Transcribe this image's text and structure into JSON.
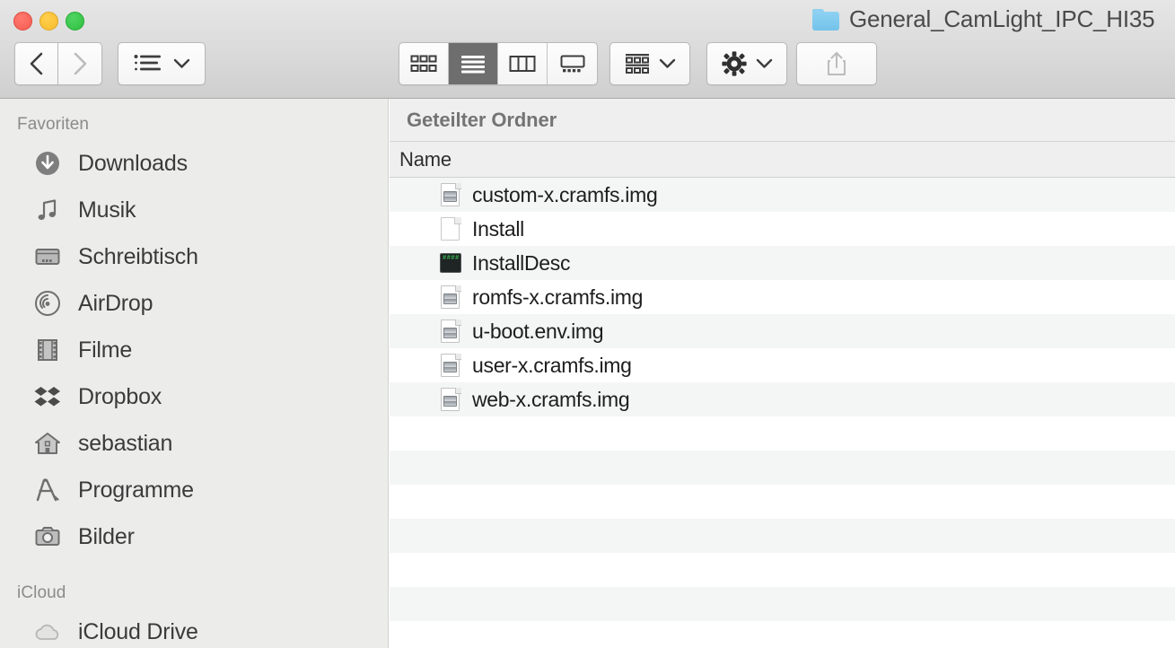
{
  "window": {
    "title": "General_CamLight_IPC_HI35",
    "folder_icon": "folder-icon",
    "traffic_lights": {
      "close": "close-button",
      "minimize": "minimize-button",
      "zoom": "zoom-button"
    },
    "colors": {
      "close": "#f45b51",
      "minimize": "#f7bb2c",
      "zoom": "#2ec03f",
      "toolbar_bg": "#dcdcdc",
      "sidebar_bg": "#ececeb",
      "row_stripe": "#f4f5f5",
      "active_segment": "#6e6e6e",
      "folder_blue": "#73c2ea"
    }
  },
  "toolbar": {
    "back": "back-button",
    "forward": "forward-button",
    "arrange": "arrange-items-button",
    "view_modes": [
      {
        "name": "icon-view",
        "active": false
      },
      {
        "name": "list-view",
        "active": true
      },
      {
        "name": "column-view",
        "active": false
      },
      {
        "name": "gallery-view",
        "active": false
      }
    ],
    "group_by": "group-by-button",
    "action": "action-button",
    "share": "share-button"
  },
  "sidebar": {
    "sections": [
      {
        "title": "Favoriten",
        "items": [
          {
            "label": "Downloads",
            "icon": "downloads-icon"
          },
          {
            "label": "Musik",
            "icon": "music-icon"
          },
          {
            "label": "Schreibtisch",
            "icon": "desktop-icon"
          },
          {
            "label": "AirDrop",
            "icon": "airdrop-icon"
          },
          {
            "label": "Filme",
            "icon": "movies-icon"
          },
          {
            "label": "Dropbox",
            "icon": "dropbox-icon"
          },
          {
            "label": "sebastian",
            "icon": "home-icon"
          },
          {
            "label": "Programme",
            "icon": "applications-icon"
          },
          {
            "label": "Bilder",
            "icon": "pictures-icon"
          }
        ]
      },
      {
        "title": "iCloud",
        "items": [
          {
            "label": "iCloud Drive",
            "icon": "icloud-drive-icon"
          }
        ]
      }
    ]
  },
  "content": {
    "path_label": "Geteilter Ordner",
    "columns": [
      "Name"
    ],
    "files": [
      {
        "name": "custom-x.cramfs.img",
        "icon": "disk-image-icon"
      },
      {
        "name": "Install",
        "icon": "document-icon"
      },
      {
        "name": "InstallDesc",
        "icon": "terminal-script-icon"
      },
      {
        "name": "romfs-x.cramfs.img",
        "icon": "disk-image-icon"
      },
      {
        "name": "u-boot.env.img",
        "icon": "disk-image-icon"
      },
      {
        "name": "user-x.cramfs.img",
        "icon": "disk-image-icon"
      },
      {
        "name": "web-x.cramfs.img",
        "icon": "disk-image-icon"
      }
    ],
    "empty_row_count": 7
  }
}
